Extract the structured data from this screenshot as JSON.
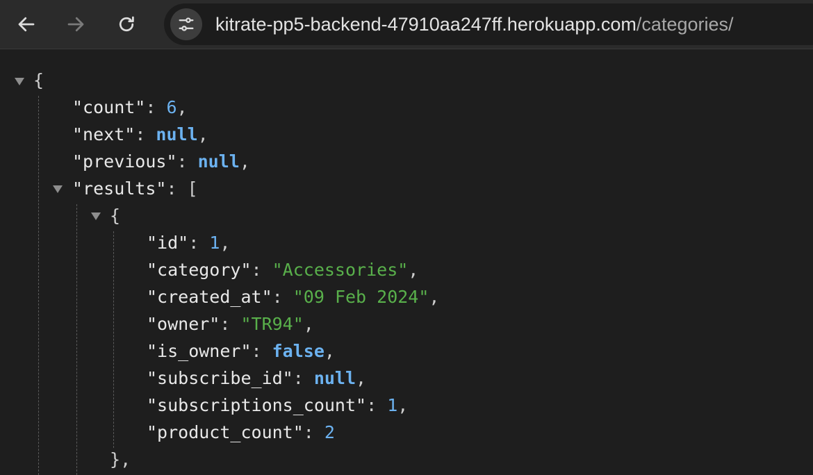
{
  "browser": {
    "url_domain": "kitrate-pp5-backend-47910aa247ff.herokuapp.com",
    "url_path": "/categories/",
    "icons": [
      "back-arrow-icon",
      "forward-arrow-icon",
      "reload-icon",
      "tune-icon"
    ]
  },
  "json": {
    "open_brace": "{",
    "close_brace": "}",
    "open_bracket": "[",
    "comma": ",",
    "colon": ": ",
    "count": {
      "key": "\"count\"",
      "value": "6"
    },
    "next": {
      "key": "\"next\"",
      "value": "null"
    },
    "previous": {
      "key": "\"previous\"",
      "value": "null"
    },
    "results": {
      "key": "\"results\""
    },
    "item": {
      "id": {
        "key": "\"id\"",
        "value": "1"
      },
      "category": {
        "key": "\"category\"",
        "value": "\"Accessories\""
      },
      "created_at": {
        "key": "\"created_at\"",
        "value": "\"09 Feb 2024\""
      },
      "owner": {
        "key": "\"owner\"",
        "value": "\"TR94\""
      },
      "is_owner": {
        "key": "\"is_owner\"",
        "value": "false"
      },
      "subscribe_id": {
        "key": "\"subscribe_id\"",
        "value": "null"
      },
      "subscriptions_count": {
        "key": "\"subscriptions_count\"",
        "value": "1"
      },
      "product_count": {
        "key": "\"product_count\"",
        "value": "2"
      }
    }
  },
  "colors": {
    "background": "#1e1e1e",
    "toolbar": "#2b2b2b",
    "number": "#6cb2f0",
    "string": "#59b04b",
    "key": "#e8e8e8"
  }
}
